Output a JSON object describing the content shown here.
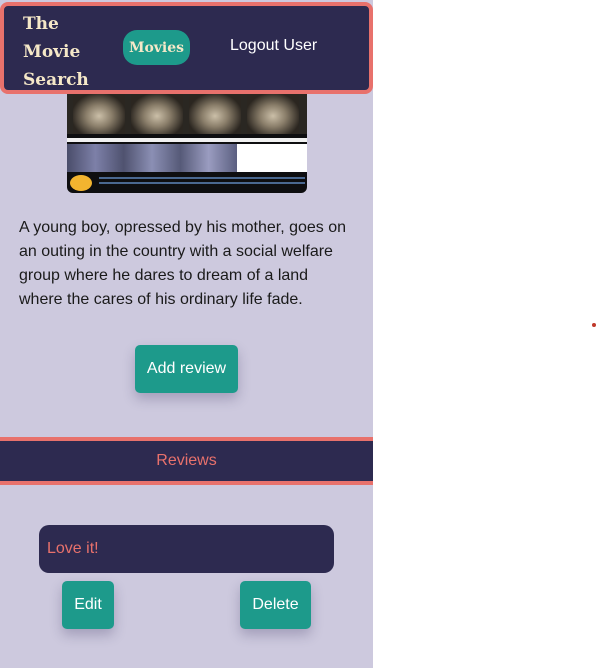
{
  "navbar": {
    "brand": "The Movie Search",
    "movies_label": "Movies",
    "logout_label": "Logout User"
  },
  "movie": {
    "plot": "A young boy, opressed by his mother, goes on an outing in the country with a social welfare group where he dares to dream of a land where the cares of his ordinary life fade."
  },
  "actions": {
    "add_review_label": "Add review"
  },
  "reviews": {
    "heading": "Reviews",
    "items": [
      {
        "text": "Love it!",
        "edit_label": "Edit",
        "delete_label": "Delete"
      }
    ]
  },
  "colors": {
    "navy": "#2d2a50",
    "coral": "#e8716c",
    "teal": "#1d9a8b",
    "lavender": "#cdc9de",
    "cream": "#f5e8c8"
  }
}
